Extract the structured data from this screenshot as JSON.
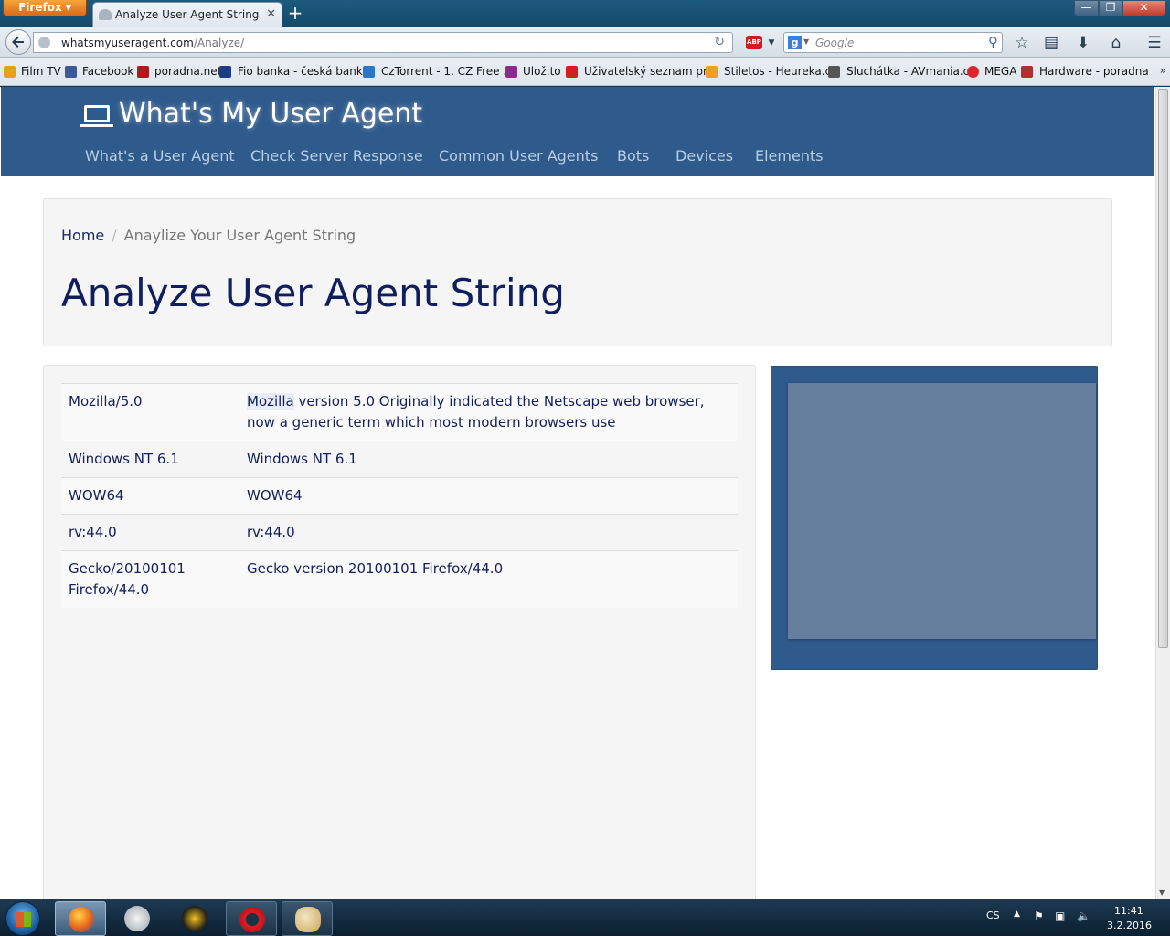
{
  "browser": {
    "menu_label": "Firefox ▾",
    "tab_title": "Analyze User Agent String",
    "tab_close": "✕",
    "new_tab": "+",
    "window_min": "—",
    "window_max": "❐",
    "window_close": "✕",
    "url_host": "whatsmyuseragent.com",
    "url_path": "/Analyze/",
    "search_placeholder": "Google",
    "abp_label": "ABP"
  },
  "bookmarks": [
    {
      "label": "Film TV",
      "color": "#e3a21a"
    },
    {
      "label": "Facebook",
      "color": "#3b5998"
    },
    {
      "label": "poradna.net",
      "color": "#b01919"
    },
    {
      "label": "Fio banka - česká bank...",
      "color": "#1d3d85"
    },
    {
      "label": "CzTorrent - 1. CZ Free ...",
      "color": "#2876c5"
    },
    {
      "label": "Ulož.to",
      "color": "#8b2a8f"
    },
    {
      "label": "Uživatelský seznam pr...",
      "color": "#d02020"
    },
    {
      "label": "Stiletos - Heureka.cz",
      "color": "#f0a020"
    },
    {
      "label": "Sluchátka - AVmania.cz",
      "color": "#555555"
    },
    {
      "label": "MEGA",
      "color": "#d9272e"
    },
    {
      "label": "Hardware - poradna",
      "color": "#b03030"
    }
  ],
  "site": {
    "brand": "What's My User Agent",
    "nav": [
      "What's a User Agent",
      "Check Server Response",
      "Common User Agents",
      "Bots",
      "Devices",
      "Elements"
    ],
    "breadcrumb_home": "Home",
    "breadcrumb_sep": "/",
    "breadcrumb_current": "Anaylize Your User Agent String",
    "page_title": "Analyze User Agent String",
    "header_color": "#2e5a8c"
  },
  "ua_rows": [
    {
      "token": "Mozilla/5.0",
      "link": "Mozilla",
      "desc": " version 5.0 Originally indicated the Netscape web browser, now a generic term which most modern browsers use"
    },
    {
      "token": "Windows NT 6.1",
      "link": "",
      "desc": "Windows NT 6.1"
    },
    {
      "token": "WOW64",
      "link": "",
      "desc": "WOW64"
    },
    {
      "token": "rv:44.0",
      "link": "",
      "desc": "rv:44.0"
    },
    {
      "token": "Gecko/20100101 Firefox/44.0",
      "link": "",
      "desc": "Gecko version 20100101 Firefox/44.0"
    }
  ],
  "taskbar": {
    "lang": "CS",
    "time": "11:41",
    "date": "3.2.2016"
  }
}
